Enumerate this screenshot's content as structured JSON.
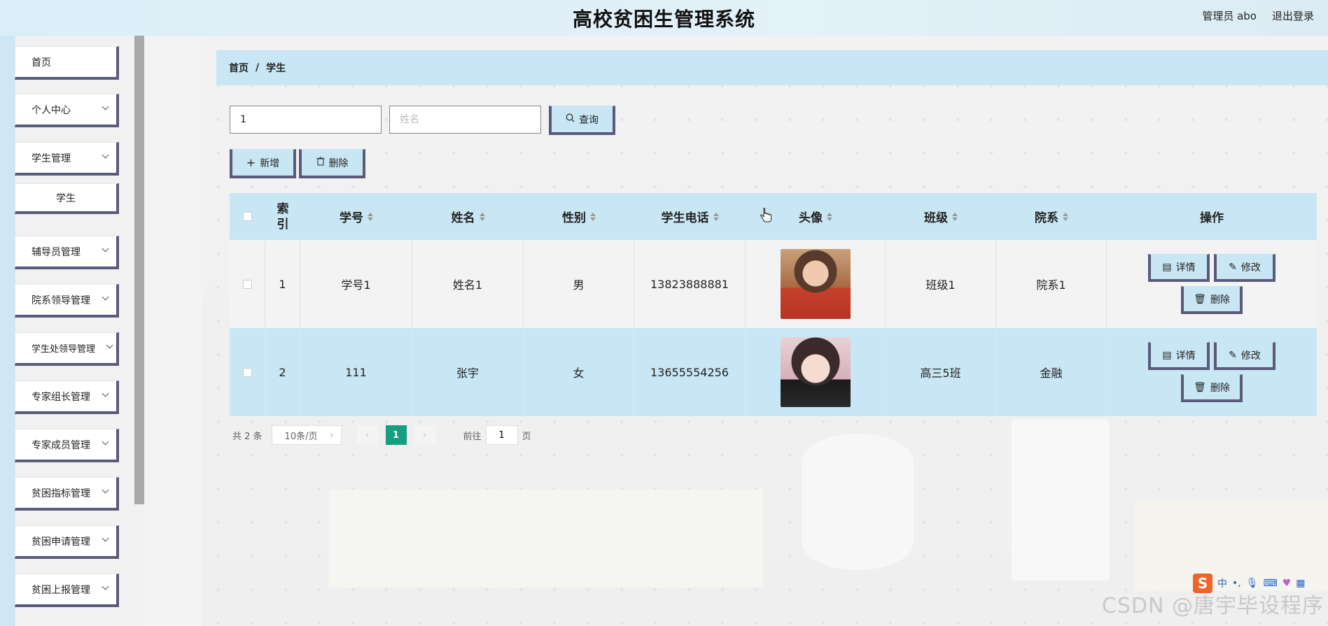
{
  "header": {
    "title": "高校贫困生管理系统",
    "user_label": "管理员 abo",
    "logout_label": "退出登录"
  },
  "sidebar": {
    "items": [
      {
        "label": "首页",
        "expandable": false
      },
      {
        "label": "个人中心",
        "expandable": true
      },
      {
        "label": "学生管理",
        "expandable": true
      },
      {
        "label": "学生",
        "expandable": false,
        "sub": true
      },
      {
        "label": "辅导员管理",
        "expandable": true
      },
      {
        "label": "院系领导管理",
        "expandable": true
      },
      {
        "label": "学生处领导管理",
        "expandable": true
      },
      {
        "label": "专家组长管理",
        "expandable": true
      },
      {
        "label": "专家成员管理",
        "expandable": true
      },
      {
        "label": "贫困指标管理",
        "expandable": true
      },
      {
        "label": "贫困申请管理",
        "expandable": true
      },
      {
        "label": "贫困上报管理",
        "expandable": true
      }
    ]
  },
  "breadcrumb": {
    "home": "首页",
    "separator": "/",
    "current": "学生"
  },
  "search": {
    "student_no_value": "1",
    "name_value": "",
    "name_placeholder": "姓名",
    "query_label": "查询"
  },
  "toolbar": {
    "add_label": "新增",
    "delete_label": "删除"
  },
  "table": {
    "columns": [
      "索引",
      "学号",
      "姓名",
      "性别",
      "学生电话",
      "头像",
      "班级",
      "院系",
      "操作"
    ],
    "rows": [
      {
        "index": "1",
        "student_no": "学号1",
        "name": "姓名1",
        "gender": "男",
        "phone": "13823888881",
        "avatar": "student-photo-1",
        "class": "班级1",
        "department": "院系1"
      },
      {
        "index": "2",
        "student_no": "111",
        "name": "张宇",
        "gender": "女",
        "phone": "13655554256",
        "avatar": "student-photo-2",
        "class": "高三5班",
        "department": "金融"
      }
    ],
    "actions": {
      "detail_label": "详情",
      "edit_label": "修改",
      "delete_label": "删除"
    }
  },
  "pagination": {
    "total_text": "共 2 条",
    "page_size": "10条/页",
    "current_page": "1",
    "goto_prefix": "前往",
    "goto_value": "1",
    "goto_suffix": "页"
  },
  "watermark": "CSDN @唐宇毕设程序",
  "ime": {
    "logo": "S",
    "mode": "中",
    "punct": "•,"
  },
  "colors": {
    "accent": "#c8e6f3",
    "button_border": "#5a5a7a",
    "active_page": "#159f7e"
  }
}
